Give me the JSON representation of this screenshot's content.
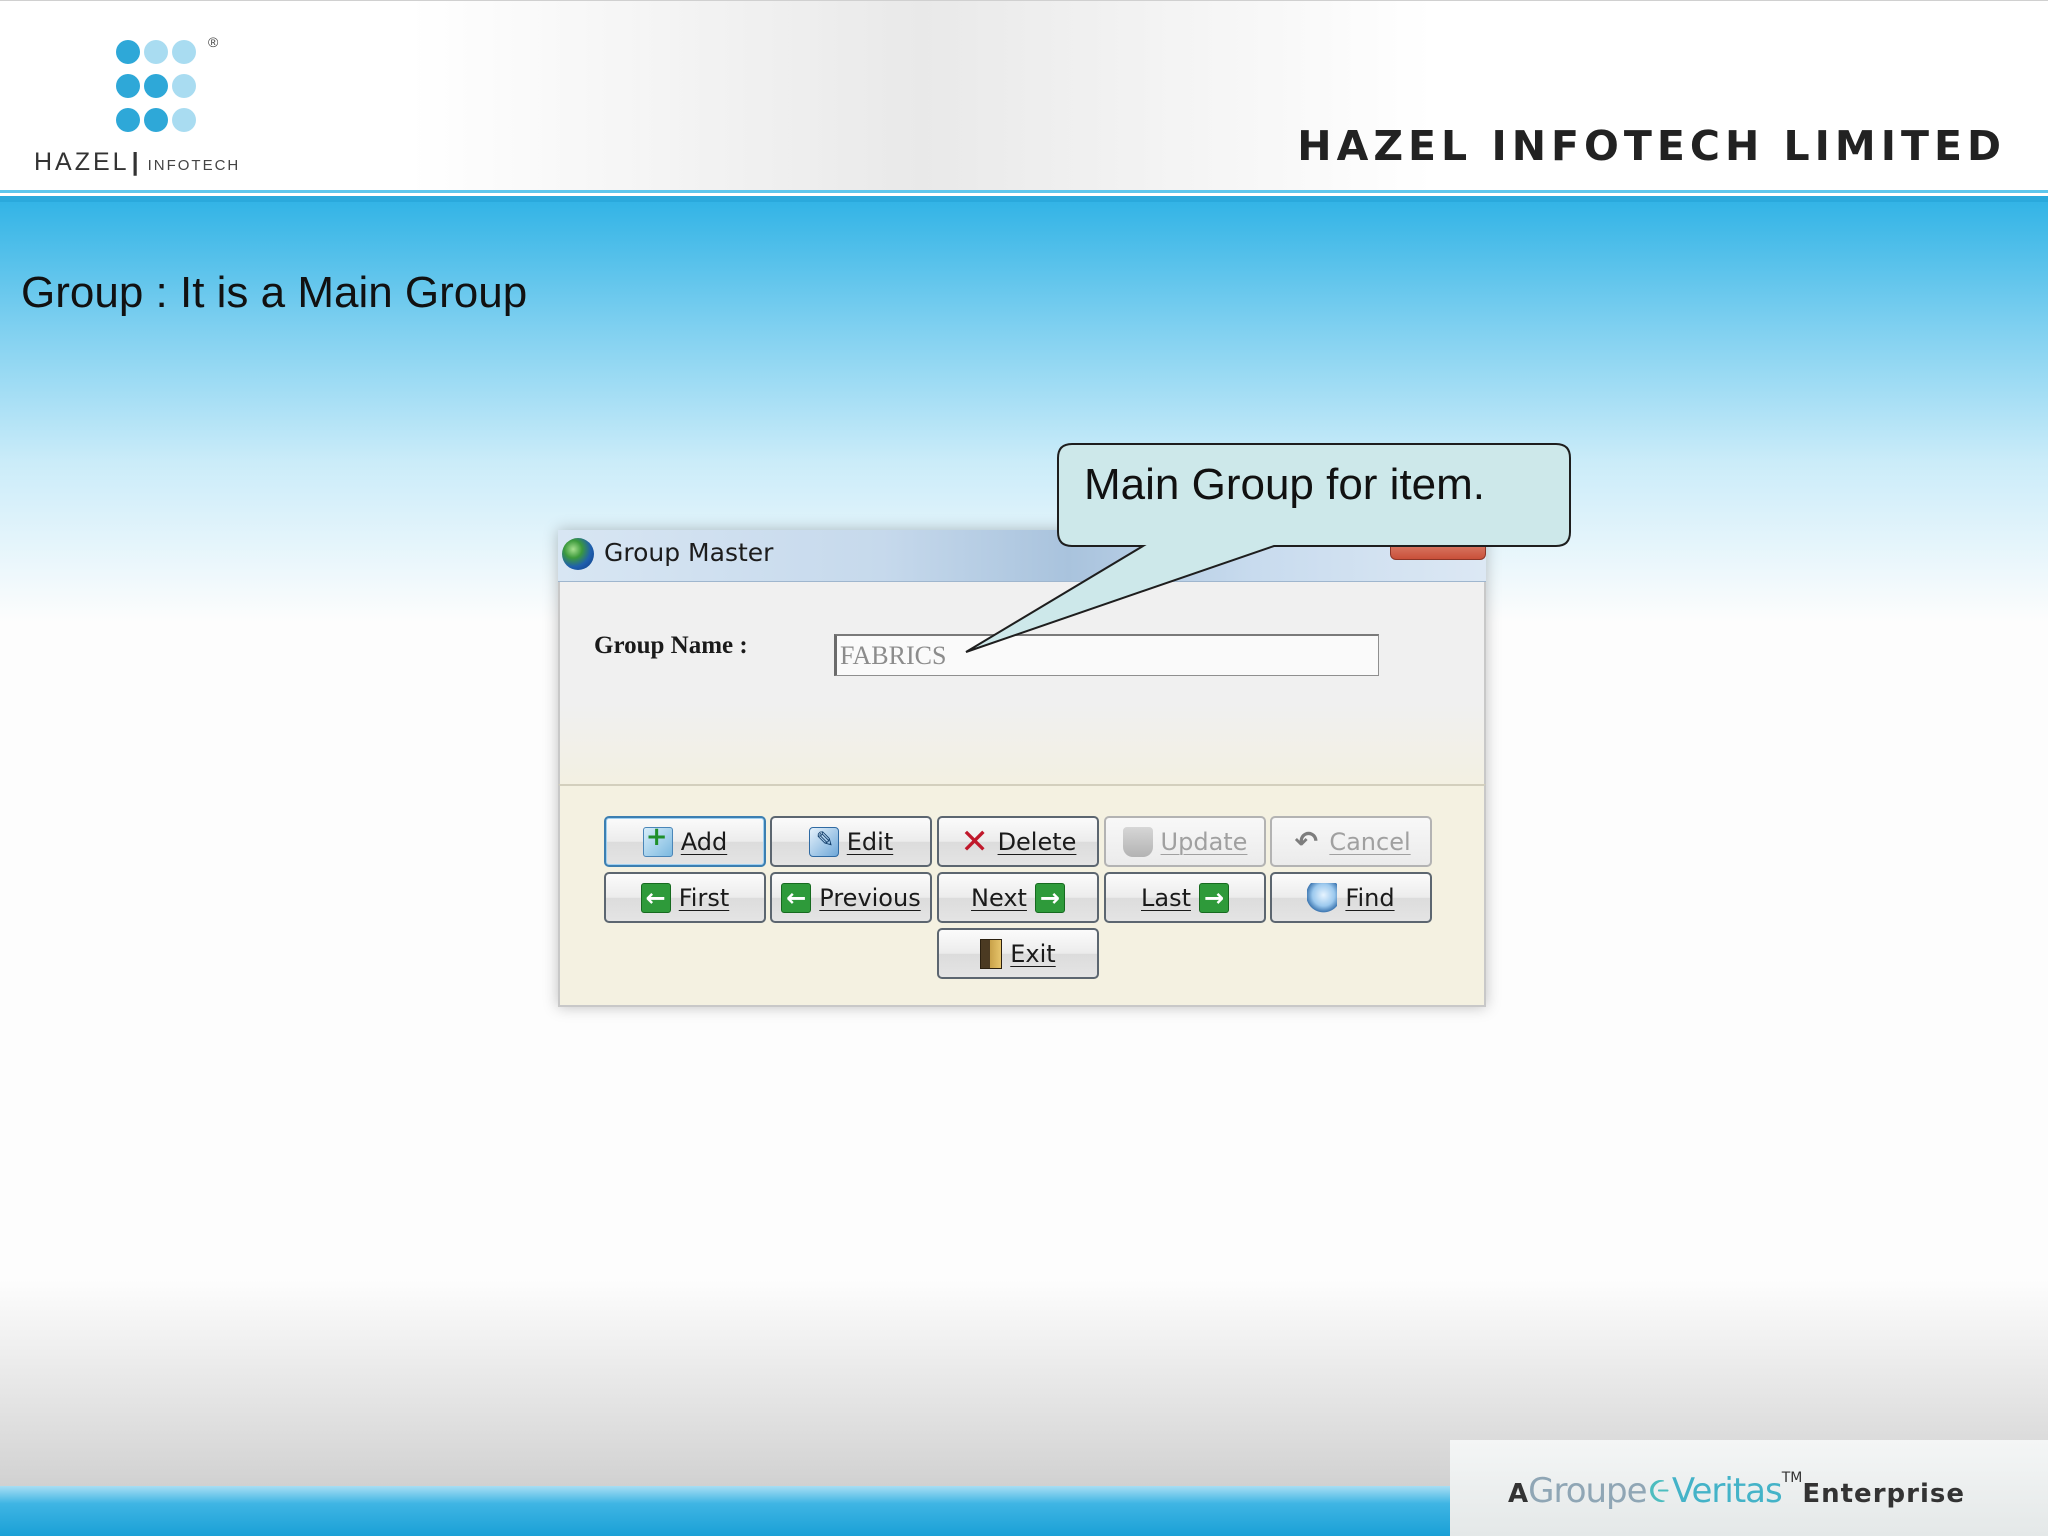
{
  "header": {
    "logo_wordmark_main": "HAZEL",
    "logo_wordmark_sub": "INFOTECH",
    "logo_registered": "®",
    "company_name": "HAZEL INFOTECH LIMITED"
  },
  "slide": {
    "title": "Group : It is a Main Group"
  },
  "callout": {
    "text": "Main Group for item."
  },
  "dialog": {
    "title": "Group Master",
    "field_label": "Group Name :",
    "group_name_value": "FABRICS",
    "buttons": {
      "add": "Add",
      "edit": "Edit",
      "delete": "Delete",
      "update": "Update",
      "cancel": "Cancel",
      "first": "First",
      "previous": "Previous",
      "next": "Next",
      "last": "Last",
      "find": "Find",
      "exit": "Exit"
    },
    "disabled_buttons": [
      "Update",
      "Cancel"
    ]
  },
  "footer": {
    "brand_prefix": "A",
    "brand_groupe": "Groupe",
    "brand_veritas": "Veritas",
    "brand_tm": "TM",
    "brand_suffix": "Enterprise"
  },
  "icons": {
    "logo": "hazel-dots-logo",
    "window": "globe-icon",
    "add": "add-document-icon",
    "edit": "edit-icon",
    "delete": "red-x-icon",
    "update": "update-icon",
    "cancel": "undo-icon",
    "first": "green-arrow-left-icon",
    "previous": "green-arrow-left-icon",
    "next": "green-arrow-right-icon",
    "last": "green-arrow-right-icon",
    "find": "magnifier-icon",
    "exit": "door-exit-icon"
  },
  "colors": {
    "accent_blue": "#2aa9dc",
    "callout_fill": "#cde8ea",
    "delete_red": "#c0182b",
    "nav_green": "#2e9a3a"
  }
}
